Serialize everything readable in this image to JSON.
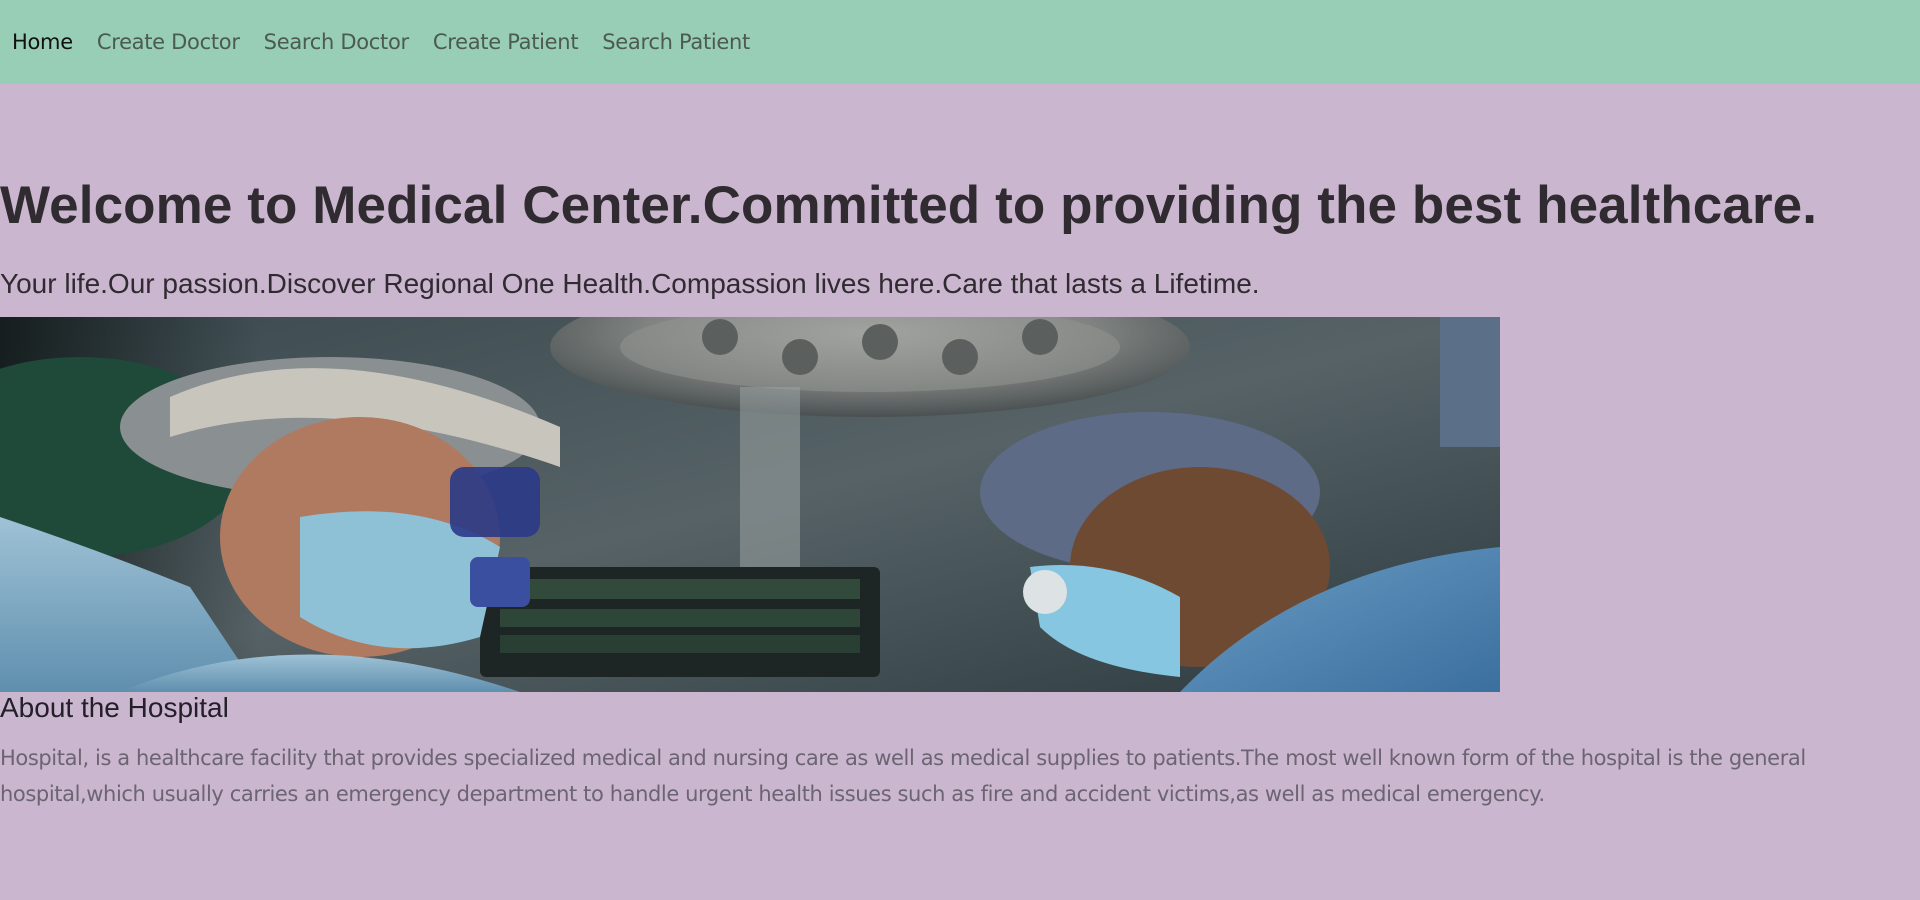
{
  "nav": {
    "items": [
      {
        "label": "Home",
        "active": true
      },
      {
        "label": "Create Doctor",
        "active": false
      },
      {
        "label": "Search Doctor",
        "active": false
      },
      {
        "label": "Create Patient",
        "active": false
      },
      {
        "label": "Search Patient",
        "active": false
      }
    ]
  },
  "hero": {
    "title": "Welcome to Medical Center.Committed to providing the best healthcare.",
    "subtitle": "Your life.Our passion.Discover Regional One Health.Compassion lives here.Care that lasts a Lifetime."
  },
  "about": {
    "title": "About the Hospital",
    "text": "Hospital, is a healthcare facility that provides specialized medical and nursing care as well as medical supplies to patients.The most well known form of the hospital is the general hospital,which usually carries an emergency department to handle urgent health issues such as fire and accident victims,as well as medical emergency."
  },
  "colors": {
    "page_background": "#cbb6cf",
    "navbar_background": "#97ceb5",
    "heading_text": "#2f2b31",
    "body_text": "#6b6472"
  }
}
